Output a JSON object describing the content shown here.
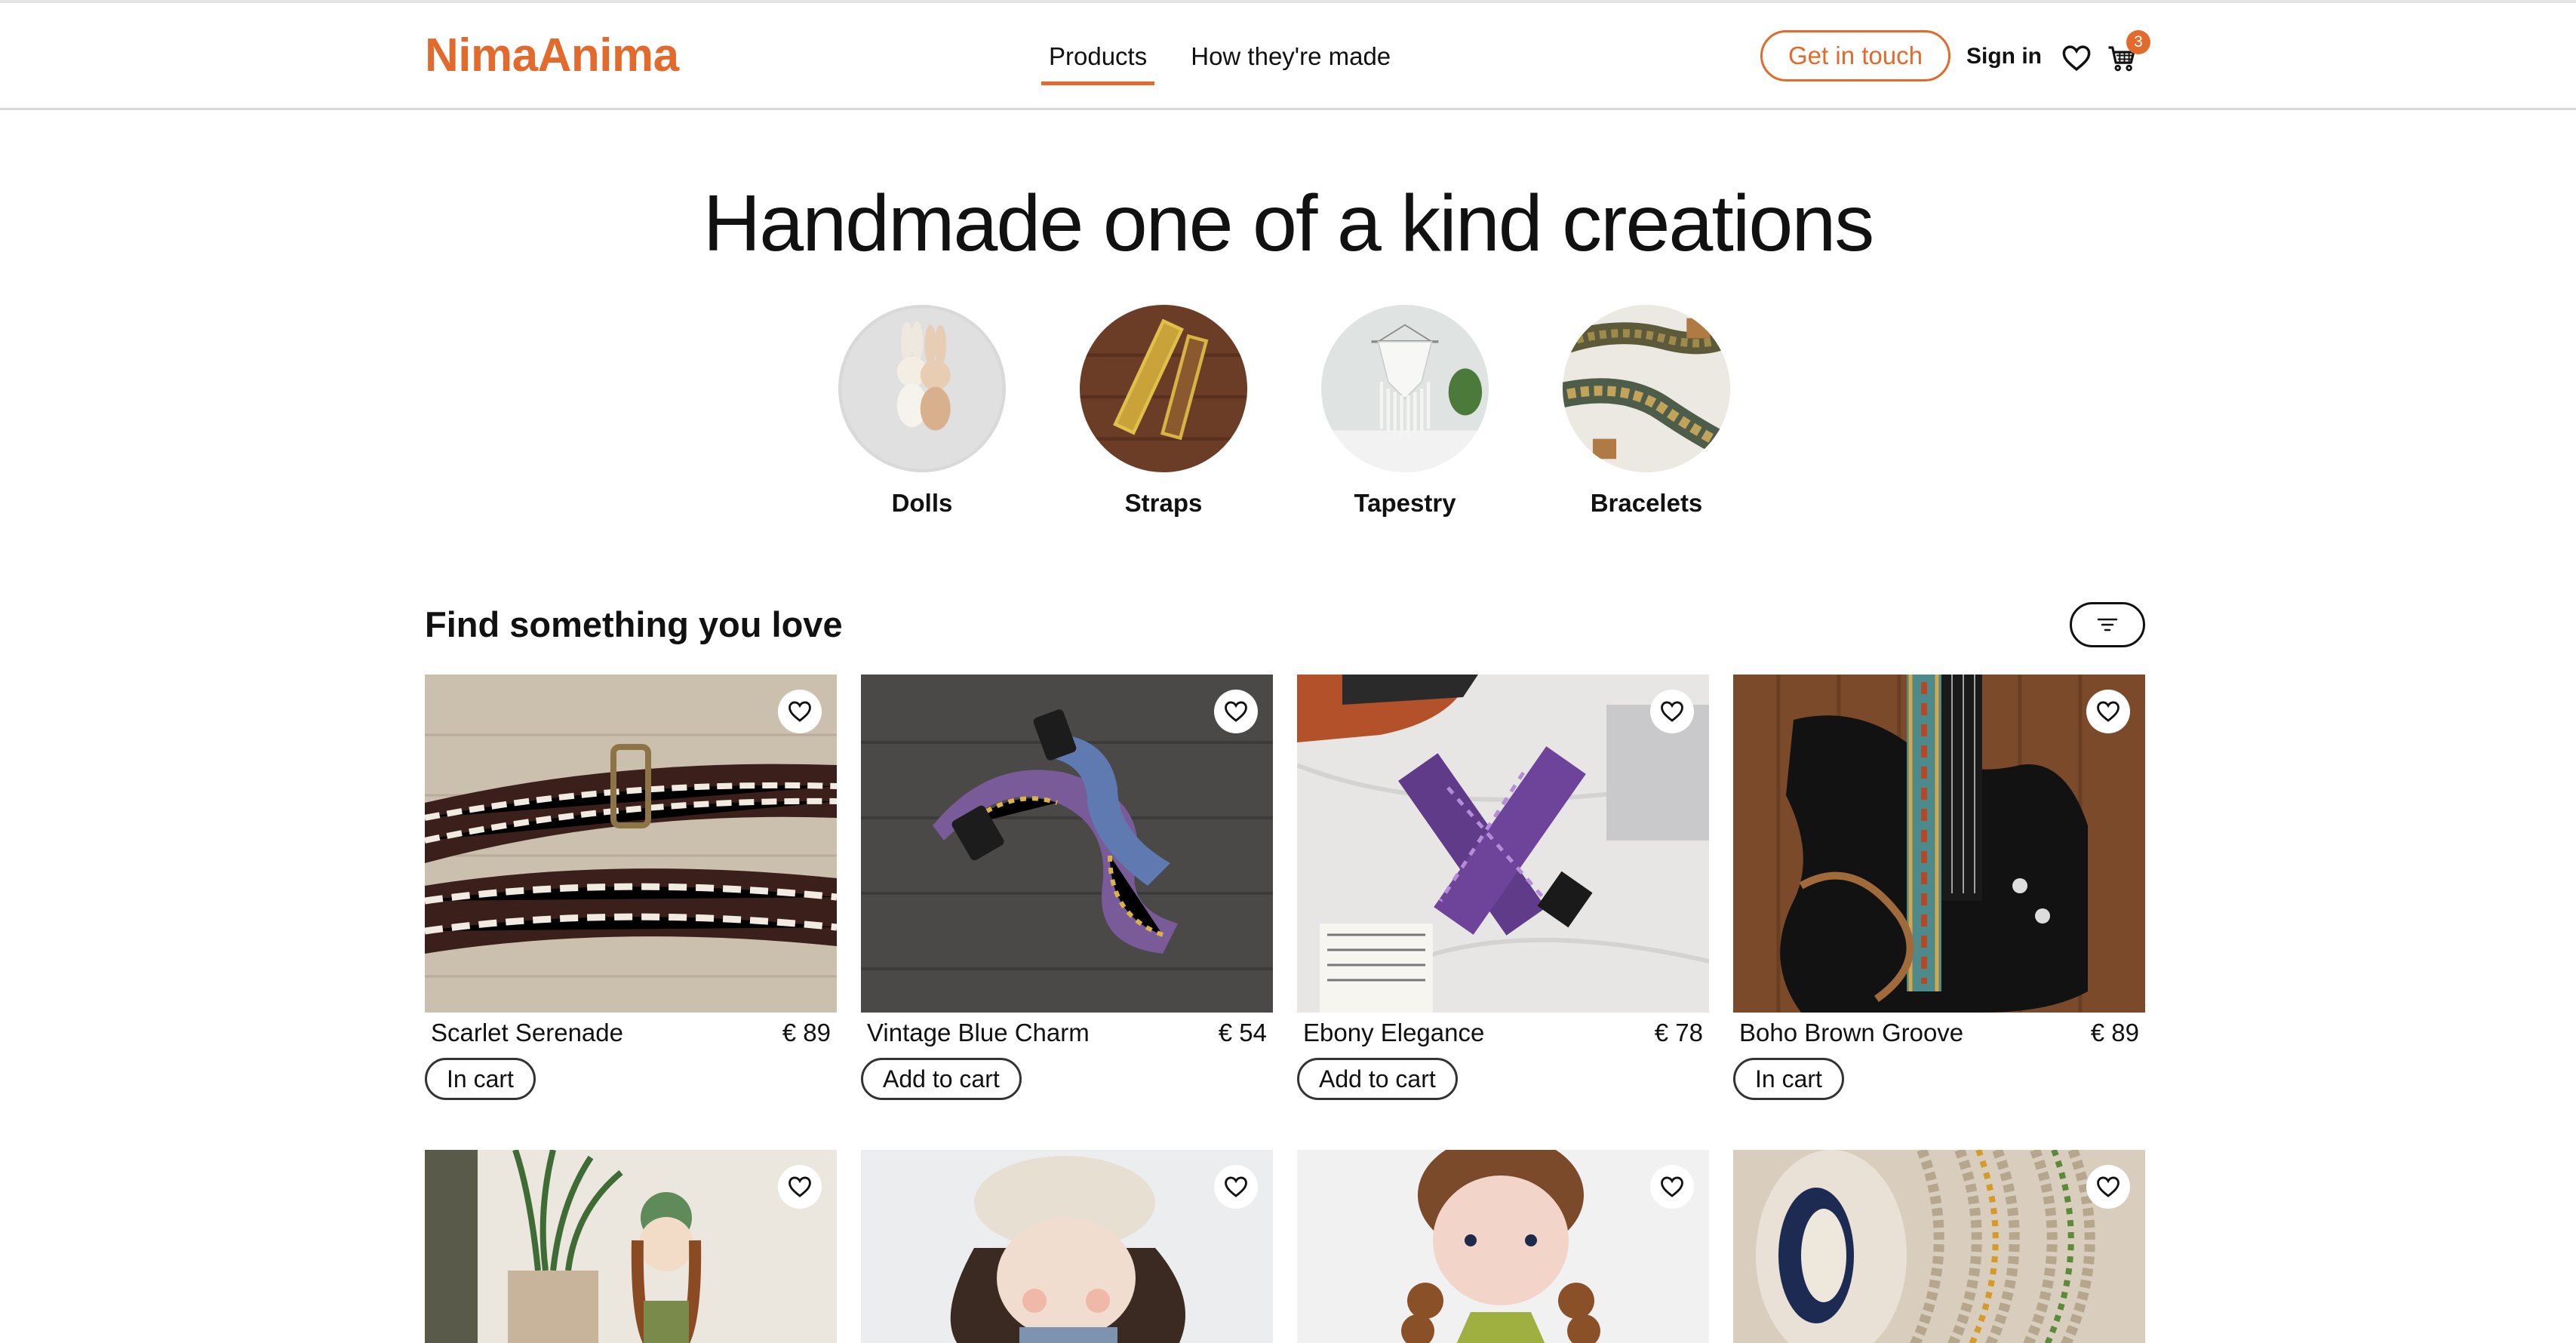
{
  "header": {
    "logo": "NimaAnima",
    "nav": [
      {
        "label": "Products",
        "active": true
      },
      {
        "label": "How they're made",
        "active": false
      }
    ],
    "cta_label": "Get in touch",
    "signin_label": "Sign in",
    "wishlist_icon": "heart-icon",
    "cart_icon": "cart-icon",
    "cart_count": "3",
    "accent_color": "#e26a2c"
  },
  "hero": {
    "title": "Handmade one of a kind creations"
  },
  "categories": [
    {
      "label": "Dolls"
    },
    {
      "label": "Straps"
    },
    {
      "label": "Tapestry"
    },
    {
      "label": "Bracelets"
    }
  ],
  "section": {
    "title": "Find something you love",
    "filter_icon": "filter-icon"
  },
  "products": [
    {
      "name": "Scarlet Serenade",
      "price": "€ 89",
      "button": "In cart"
    },
    {
      "name": "Vintage Blue Charm",
      "price": "€ 54",
      "button": "Add to cart"
    },
    {
      "name": "Ebony Elegance",
      "price": "€ 78",
      "button": "Add to cart"
    },
    {
      "name": "Boho Brown Groove",
      "price": "€ 89",
      "button": "In cart"
    }
  ]
}
